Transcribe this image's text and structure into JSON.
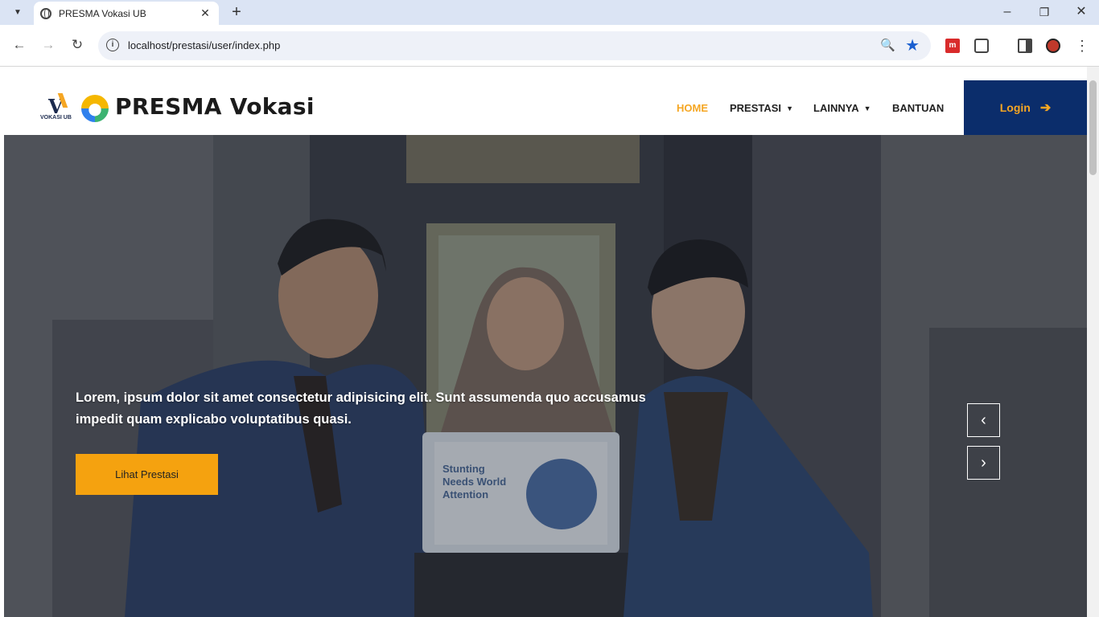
{
  "browser": {
    "tab_title": "PRESMA Vokasi UB",
    "url": "localhost/prestasi/user/index.php",
    "new_tab_symbol": "+",
    "tab_close_symbol": "✕",
    "minimize_symbol": "–",
    "restore_symbol": "❐",
    "close_symbol": "✕",
    "back_symbol": "←",
    "forward_symbol": "→",
    "reload_symbol": "↻",
    "zoom_symbol": "🔍",
    "bookmark_symbol": "★",
    "menu_symbol": "⋮"
  },
  "site": {
    "logo_letter": "V",
    "logo_sub": "VOKASI UB",
    "brand": "PRESMA Vokasi",
    "nav": [
      {
        "label": "HOME",
        "active": true
      },
      {
        "label": "PRESTASI",
        "has_dropdown": true
      },
      {
        "label": "LAINNYA",
        "has_dropdown": true
      },
      {
        "label": "BANTUAN"
      }
    ],
    "login_label": "Login",
    "login_arrow": "➔"
  },
  "hero": {
    "text": "Lorem, ipsum dolor sit amet consectetur adipisicing elit. Sunt assumenda quo accusamus impedit quam explicabo voluptatibus quasi.",
    "button_label": "Lihat Prestasi",
    "prev_symbol": "‹",
    "next_symbol": "›",
    "laptop_screen_text": "Stunting Needs World Attention"
  },
  "colors": {
    "accent": "#f5a623",
    "login_bg": "#0b2d6b",
    "hero_button": "#f5a20f"
  }
}
